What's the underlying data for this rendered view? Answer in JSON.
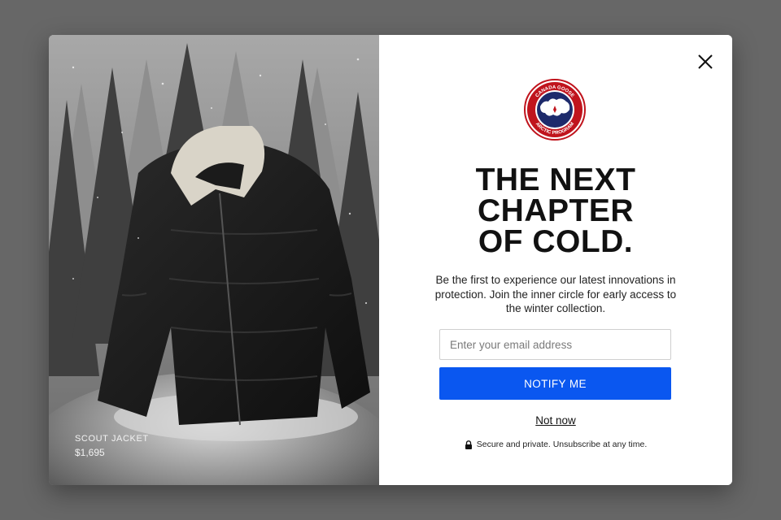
{
  "product": {
    "name": "SCOUT JACKET",
    "price": "$1,695"
  },
  "logo": {
    "text_top": "CANADA GOOSE",
    "text_bottom": "ARCTIC PROGRAM",
    "colors": {
      "ring": "#c0141d",
      "inner": "#1d2a6b",
      "map": "#ffffff"
    }
  },
  "headline": {
    "line1": "THE NEXT",
    "line2": "CHAPTER",
    "line3": "OF COLD."
  },
  "body_text": "Be the first to experience our latest innovations in protection. Join the inner circle for early access to the winter collection.",
  "email": {
    "placeholder": "Enter your email address",
    "value": ""
  },
  "notify_button": "NOTIFY ME",
  "not_now_link": "Not now",
  "secure_note": "Secure and private. Unsubscribe at any time.",
  "icons": {
    "close": "close-icon",
    "lock": "lock-icon"
  },
  "colors": {
    "accent": "#0a57f0",
    "overlay": "#676767"
  }
}
